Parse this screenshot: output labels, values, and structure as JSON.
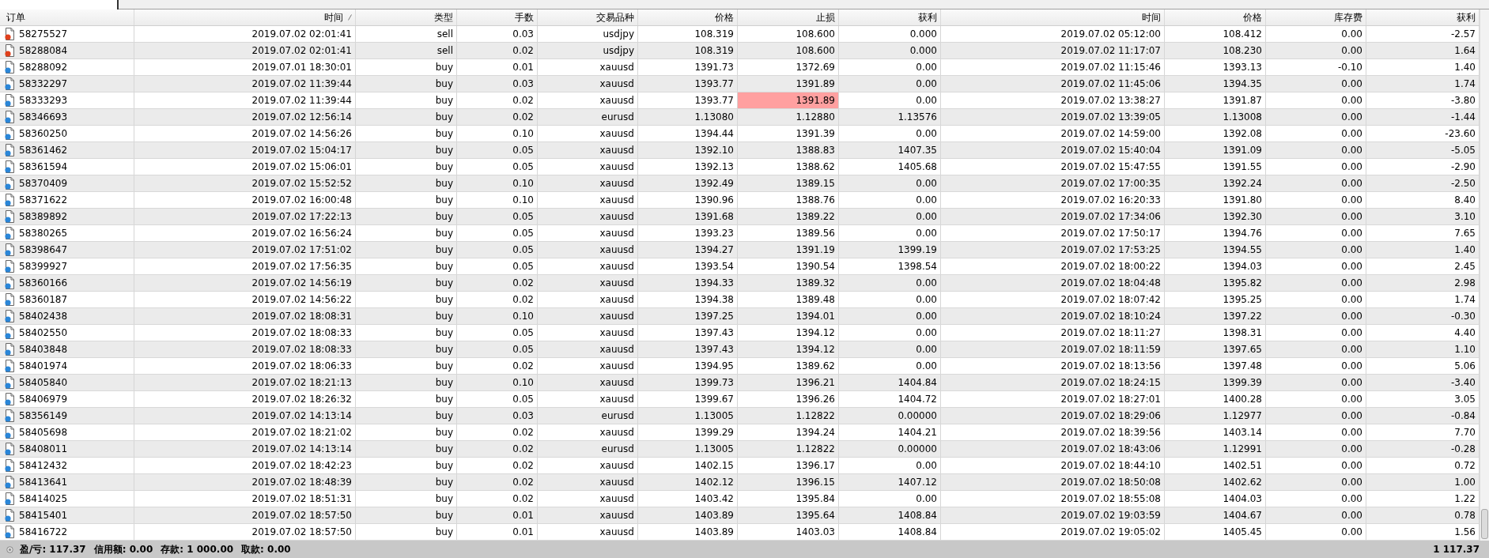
{
  "table": {
    "columns": [
      {
        "label": "订单",
        "sorted": false
      },
      {
        "label": "时间",
        "sorted": true
      },
      {
        "label": "类型",
        "sorted": false
      },
      {
        "label": "手数",
        "sorted": false
      },
      {
        "label": "交易品种",
        "sorted": false
      },
      {
        "label": "价格",
        "sorted": false
      },
      {
        "label": "止损",
        "sorted": false
      },
      {
        "label": "获利",
        "sorted": false
      },
      {
        "label": "时间",
        "sorted": false
      },
      {
        "label": "价格",
        "sorted": false
      },
      {
        "label": "库存费",
        "sorted": false
      },
      {
        "label": "获利",
        "sorted": false
      }
    ],
    "rows": [
      {
        "color": "#e0401c",
        "sl_alert": false,
        "cells": [
          "58275527",
          "2019.07.02 02:01:41",
          "sell",
          "0.03",
          "usdjpy",
          "108.319",
          "108.600",
          "0.000",
          "2019.07.02 05:12:00",
          "108.412",
          "0.00",
          "-2.57"
        ]
      },
      {
        "color": "#e0401c",
        "sl_alert": false,
        "cells": [
          "58288084",
          "2019.07.02 02:01:41",
          "sell",
          "0.02",
          "usdjpy",
          "108.319",
          "108.600",
          "0.000",
          "2019.07.02 11:17:07",
          "108.230",
          "0.00",
          "1.64"
        ]
      },
      {
        "color": "#2a86d8",
        "sl_alert": false,
        "cells": [
          "58288092",
          "2019.07.01 18:30:01",
          "buy",
          "0.01",
          "xauusd",
          "1391.73",
          "1372.69",
          "0.00",
          "2019.07.02 11:15:46",
          "1393.13",
          "-0.10",
          "1.40"
        ]
      },
      {
        "color": "#2a86d8",
        "sl_alert": false,
        "cells": [
          "58332297",
          "2019.07.02 11:39:44",
          "buy",
          "0.03",
          "xauusd",
          "1393.77",
          "1391.89",
          "0.00",
          "2019.07.02 11:45:06",
          "1394.35",
          "0.00",
          "1.74"
        ]
      },
      {
        "color": "#2a86d8",
        "sl_alert": true,
        "cells": [
          "58333293",
          "2019.07.02 11:39:44",
          "buy",
          "0.02",
          "xauusd",
          "1393.77",
          "1391.89",
          "0.00",
          "2019.07.02 13:38:27",
          "1391.87",
          "0.00",
          "-3.80"
        ]
      },
      {
        "color": "#2a86d8",
        "sl_alert": false,
        "cells": [
          "58346693",
          "2019.07.02 12:56:14",
          "buy",
          "0.02",
          "eurusd",
          "1.13080",
          "1.12880",
          "1.13576",
          "2019.07.02 13:39:05",
          "1.13008",
          "0.00",
          "-1.44"
        ]
      },
      {
        "color": "#2a86d8",
        "sl_alert": false,
        "cells": [
          "58360250",
          "2019.07.02 14:56:26",
          "buy",
          "0.10",
          "xauusd",
          "1394.44",
          "1391.39",
          "0.00",
          "2019.07.02 14:59:00",
          "1392.08",
          "0.00",
          "-23.60"
        ]
      },
      {
        "color": "#2a86d8",
        "sl_alert": false,
        "cells": [
          "58361462",
          "2019.07.02 15:04:17",
          "buy",
          "0.05",
          "xauusd",
          "1392.10",
          "1388.83",
          "1407.35",
          "2019.07.02 15:40:04",
          "1391.09",
          "0.00",
          "-5.05"
        ]
      },
      {
        "color": "#2a86d8",
        "sl_alert": false,
        "cells": [
          "58361594",
          "2019.07.02 15:06:01",
          "buy",
          "0.05",
          "xauusd",
          "1392.13",
          "1388.62",
          "1405.68",
          "2019.07.02 15:47:55",
          "1391.55",
          "0.00",
          "-2.90"
        ]
      },
      {
        "color": "#2a86d8",
        "sl_alert": false,
        "cells": [
          "58370409",
          "2019.07.02 15:52:52",
          "buy",
          "0.10",
          "xauusd",
          "1392.49",
          "1389.15",
          "0.00",
          "2019.07.02 17:00:35",
          "1392.24",
          "0.00",
          "-2.50"
        ]
      },
      {
        "color": "#2a86d8",
        "sl_alert": false,
        "cells": [
          "58371622",
          "2019.07.02 16:00:48",
          "buy",
          "0.10",
          "xauusd",
          "1390.96",
          "1388.76",
          "0.00",
          "2019.07.02 16:20:33",
          "1391.80",
          "0.00",
          "8.40"
        ]
      },
      {
        "color": "#2a86d8",
        "sl_alert": false,
        "cells": [
          "58389892",
          "2019.07.02 17:22:13",
          "buy",
          "0.05",
          "xauusd",
          "1391.68",
          "1389.22",
          "0.00",
          "2019.07.02 17:34:06",
          "1392.30",
          "0.00",
          "3.10"
        ]
      },
      {
        "color": "#2a86d8",
        "sl_alert": false,
        "cells": [
          "58380265",
          "2019.07.02 16:56:24",
          "buy",
          "0.05",
          "xauusd",
          "1393.23",
          "1389.56",
          "0.00",
          "2019.07.02 17:50:17",
          "1394.76",
          "0.00",
          "7.65"
        ]
      },
      {
        "color": "#2a86d8",
        "sl_alert": false,
        "cells": [
          "58398647",
          "2019.07.02 17:51:02",
          "buy",
          "0.05",
          "xauusd",
          "1394.27",
          "1391.19",
          "1399.19",
          "2019.07.02 17:53:25",
          "1394.55",
          "0.00",
          "1.40"
        ]
      },
      {
        "color": "#2a86d8",
        "sl_alert": false,
        "cells": [
          "58399927",
          "2019.07.02 17:56:35",
          "buy",
          "0.05",
          "xauusd",
          "1393.54",
          "1390.54",
          "1398.54",
          "2019.07.02 18:00:22",
          "1394.03",
          "0.00",
          "2.45"
        ]
      },
      {
        "color": "#2a86d8",
        "sl_alert": false,
        "cells": [
          "58360166",
          "2019.07.02 14:56:19",
          "buy",
          "0.02",
          "xauusd",
          "1394.33",
          "1389.32",
          "0.00",
          "2019.07.02 18:04:48",
          "1395.82",
          "0.00",
          "2.98"
        ]
      },
      {
        "color": "#2a86d8",
        "sl_alert": false,
        "cells": [
          "58360187",
          "2019.07.02 14:56:22",
          "buy",
          "0.02",
          "xauusd",
          "1394.38",
          "1389.48",
          "0.00",
          "2019.07.02 18:07:42",
          "1395.25",
          "0.00",
          "1.74"
        ]
      },
      {
        "color": "#2a86d8",
        "sl_alert": false,
        "cells": [
          "58402438",
          "2019.07.02 18:08:31",
          "buy",
          "0.10",
          "xauusd",
          "1397.25",
          "1394.01",
          "0.00",
          "2019.07.02 18:10:24",
          "1397.22",
          "0.00",
          "-0.30"
        ]
      },
      {
        "color": "#2a86d8",
        "sl_alert": false,
        "cells": [
          "58402550",
          "2019.07.02 18:08:33",
          "buy",
          "0.05",
          "xauusd",
          "1397.43",
          "1394.12",
          "0.00",
          "2019.07.02 18:11:27",
          "1398.31",
          "0.00",
          "4.40"
        ]
      },
      {
        "color": "#2a86d8",
        "sl_alert": false,
        "cells": [
          "58403848",
          "2019.07.02 18:08:33",
          "buy",
          "0.05",
          "xauusd",
          "1397.43",
          "1394.12",
          "0.00",
          "2019.07.02 18:11:59",
          "1397.65",
          "0.00",
          "1.10"
        ]
      },
      {
        "color": "#2a86d8",
        "sl_alert": false,
        "cells": [
          "58401974",
          "2019.07.02 18:06:33",
          "buy",
          "0.02",
          "xauusd",
          "1394.95",
          "1389.62",
          "0.00",
          "2019.07.02 18:13:56",
          "1397.48",
          "0.00",
          "5.06"
        ]
      },
      {
        "color": "#2a86d8",
        "sl_alert": false,
        "cells": [
          "58405840",
          "2019.07.02 18:21:13",
          "buy",
          "0.10",
          "xauusd",
          "1399.73",
          "1396.21",
          "1404.84",
          "2019.07.02 18:24:15",
          "1399.39",
          "0.00",
          "-3.40"
        ]
      },
      {
        "color": "#2a86d8",
        "sl_alert": false,
        "cells": [
          "58406979",
          "2019.07.02 18:26:32",
          "buy",
          "0.05",
          "xauusd",
          "1399.67",
          "1396.26",
          "1404.72",
          "2019.07.02 18:27:01",
          "1400.28",
          "0.00",
          "3.05"
        ]
      },
      {
        "color": "#2a86d8",
        "sl_alert": false,
        "cells": [
          "58356149",
          "2019.07.02 14:13:14",
          "buy",
          "0.03",
          "eurusd",
          "1.13005",
          "1.12822",
          "0.00000",
          "2019.07.02 18:29:06",
          "1.12977",
          "0.00",
          "-0.84"
        ]
      },
      {
        "color": "#2a86d8",
        "sl_alert": false,
        "cells": [
          "58405698",
          "2019.07.02 18:21:02",
          "buy",
          "0.02",
          "xauusd",
          "1399.29",
          "1394.24",
          "1404.21",
          "2019.07.02 18:39:56",
          "1403.14",
          "0.00",
          "7.70"
        ]
      },
      {
        "color": "#2a86d8",
        "sl_alert": false,
        "cells": [
          "58408011",
          "2019.07.02 14:13:14",
          "buy",
          "0.02",
          "eurusd",
          "1.13005",
          "1.12822",
          "0.00000",
          "2019.07.02 18:43:06",
          "1.12991",
          "0.00",
          "-0.28"
        ]
      },
      {
        "color": "#2a86d8",
        "sl_alert": false,
        "cells": [
          "58412432",
          "2019.07.02 18:42:23",
          "buy",
          "0.02",
          "xauusd",
          "1402.15",
          "1396.17",
          "0.00",
          "2019.07.02 18:44:10",
          "1402.51",
          "0.00",
          "0.72"
        ]
      },
      {
        "color": "#2a86d8",
        "sl_alert": false,
        "cells": [
          "58413641",
          "2019.07.02 18:48:39",
          "buy",
          "0.02",
          "xauusd",
          "1402.12",
          "1396.15",
          "1407.12",
          "2019.07.02 18:50:08",
          "1402.62",
          "0.00",
          "1.00"
        ]
      },
      {
        "color": "#2a86d8",
        "sl_alert": false,
        "cells": [
          "58414025",
          "2019.07.02 18:51:31",
          "buy",
          "0.02",
          "xauusd",
          "1403.42",
          "1395.84",
          "0.00",
          "2019.07.02 18:55:08",
          "1404.03",
          "0.00",
          "1.22"
        ]
      },
      {
        "color": "#2a86d8",
        "sl_alert": false,
        "cells": [
          "58415401",
          "2019.07.02 18:57:50",
          "buy",
          "0.01",
          "xauusd",
          "1403.89",
          "1395.64",
          "1408.84",
          "2019.07.02 19:03:59",
          "1404.67",
          "0.00",
          "0.78"
        ]
      },
      {
        "color": "#2a86d8",
        "sl_alert": false,
        "cells": [
          "58416722",
          "2019.07.02 18:57:50",
          "buy",
          "0.01",
          "xauusd",
          "1403.89",
          "1403.03",
          "1408.84",
          "2019.07.02 19:05:02",
          "1405.45",
          "0.00",
          "1.56"
        ]
      }
    ]
  },
  "status_bar": {
    "items": [
      {
        "label": "盈/亏:",
        "value": "117.37"
      },
      {
        "label": "信用额:",
        "value": "0.00"
      },
      {
        "label": "存款:",
        "value": "1 000.00"
      },
      {
        "label": "取款:",
        "value": "0.00"
      }
    ],
    "total": "1 117.37"
  }
}
